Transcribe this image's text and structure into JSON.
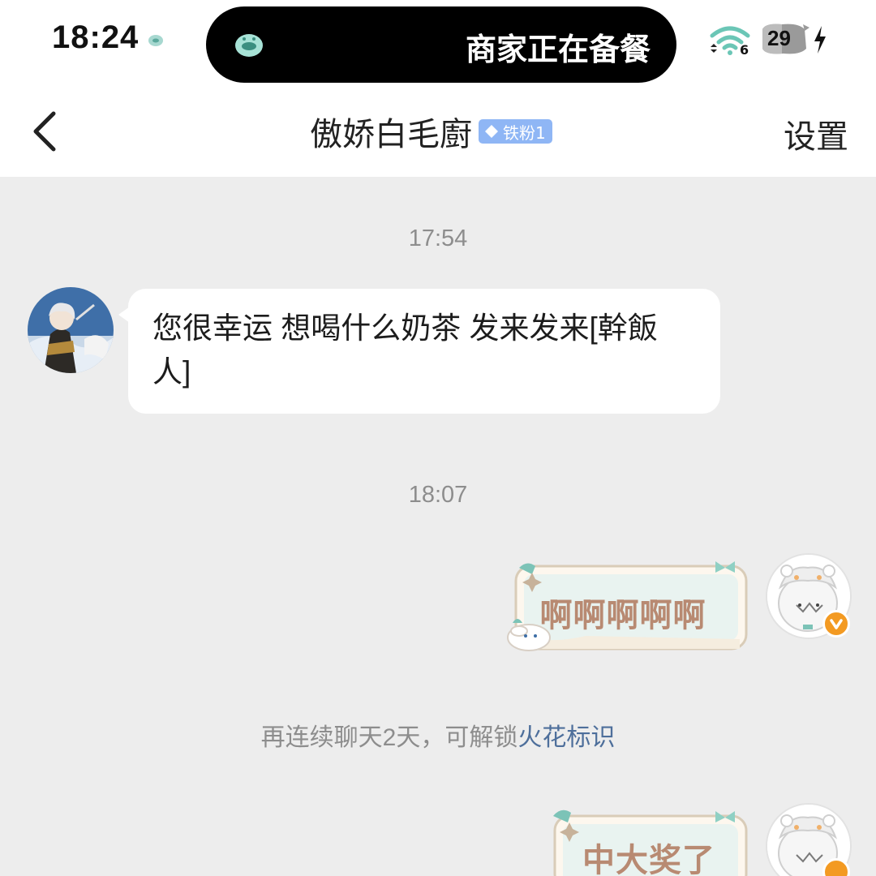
{
  "status_bar": {
    "time": "18:24",
    "island_text": "商家正在备餐",
    "wifi_label": "6",
    "battery_level": "29",
    "icons": [
      "app-notification-icon",
      "wifi-icon",
      "battery-icon",
      "charging-icon"
    ]
  },
  "nav": {
    "back_icon": "chevron-left-icon",
    "title": "傲娇白毛廚",
    "fan_badge": "铁粉1",
    "settings_label": "设置"
  },
  "chat": {
    "timestamps": [
      "17:54",
      "18:07"
    ],
    "messages": [
      {
        "direction": "incoming",
        "text": "您很幸运 想喝什么奶茶 发来发来[幹飯人]"
      },
      {
        "direction": "outgoing",
        "style": "sticker-bubble",
        "text": "啊啊啊啊啊"
      },
      {
        "direction": "outgoing",
        "style": "sticker-bubble",
        "text": "中大奖了"
      }
    ],
    "system_tip": {
      "prefix": "再连续聊天2天，可解锁",
      "link": "火花标识"
    }
  },
  "colors": {
    "background": "#ededed",
    "bubble_incoming": "#ffffff",
    "sticker_text": "#b88a72",
    "link": "#4e6f9b",
    "badge": "#8fb6f5",
    "verified": "#f39a22"
  }
}
